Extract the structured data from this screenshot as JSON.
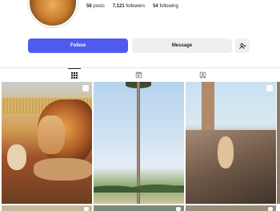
{
  "profile": {
    "stats": {
      "posts_count": "56",
      "posts_label": "posts",
      "followers_count": "7,121",
      "followers_label": "followers",
      "following_count": "54",
      "following_label": "following"
    }
  },
  "actions": {
    "follow_label": "Follow",
    "message_label": "Message"
  },
  "tabs": [
    "posts-grid",
    "reels",
    "tagged"
  ],
  "colors": {
    "follow_button": "#4f5bf0",
    "secondary_button": "#efefef",
    "text": "#262626"
  }
}
